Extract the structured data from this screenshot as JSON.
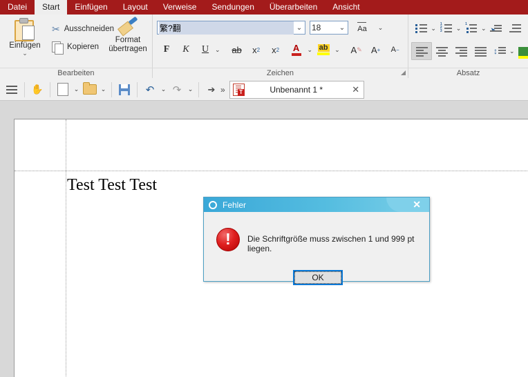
{
  "menubar": {
    "items": [
      {
        "label": "Datei",
        "active": false
      },
      {
        "label": "Start",
        "active": true
      },
      {
        "label": "Einfügen",
        "active": false
      },
      {
        "label": "Layout",
        "active": false
      },
      {
        "label": "Verweise",
        "active": false
      },
      {
        "label": "Sendungen",
        "active": false
      },
      {
        "label": "Überarbeiten",
        "active": false
      },
      {
        "label": "Ansicht",
        "active": false
      }
    ],
    "accent_color": "#a31b1b",
    "active_bg": "#eeeeee"
  },
  "ribbon": {
    "groups": [
      {
        "label": "Bearbeiten",
        "has_launcher": false
      },
      {
        "label": "Zeichen",
        "has_launcher": true
      },
      {
        "label": "Absatz",
        "has_launcher": false
      }
    ],
    "bearbeiten": {
      "paste_label": "Einfügen",
      "paste_chevron": "⌄",
      "cut_label": "Ausschneiden",
      "copy_label": "Kopieren",
      "format_painter_line1": "Format",
      "format_painter_line2": "übertragen"
    },
    "zeichen": {
      "font_name": "繁?翻",
      "font_size": "18",
      "combo_chevron": "⌄",
      "change_case_label": "Aa",
      "bold_label": "F",
      "italic_label": "K",
      "underline_label": "U",
      "strikethrough_label": "ab",
      "subscript_label": "x",
      "subscript_index": "2",
      "superscript_label": "x",
      "superscript_index": "2",
      "font_color_label": "A",
      "font_color_hex": "#c9211e",
      "highlight_label": "ab",
      "highlight_hex": "#ffff00",
      "clear_format_label": "A",
      "grow_font_label": "A",
      "grow_font_sign": "+",
      "shrink_font_label": "A",
      "shrink_font_sign": "−"
    },
    "absatz": {
      "bullet_list": "bullet-list",
      "numbered_list": "numbered-list",
      "outline_list": "outline-list",
      "increase_indent": "increase-indent",
      "decrease_indent": "decrease-indent",
      "align_left": "align-left",
      "align_center": "align-center",
      "align_right": "align-right",
      "align_justify": "align-justify",
      "line_spacing": "line-spacing",
      "shading": "shading",
      "numbers": [
        "1",
        "2",
        "3"
      ],
      "outline_number": "1"
    }
  },
  "toolbar2": {
    "menu_icon": "hamburger-icon",
    "hand_icon": "hand-icon",
    "new_icon": "new-document-icon",
    "open_icon": "open-folder-icon",
    "save_icon": "save-icon",
    "undo_icon": "undo-icon",
    "redo_icon": "redo-icon",
    "select_icon": "select-cursor-icon",
    "overflow_label": "»",
    "chevron": "⌄",
    "document_tab": {
      "title": "Unbenannt 1 *",
      "close_label": "✕",
      "badge": "T"
    }
  },
  "document": {
    "body_text": "Test Test Test",
    "page_background": "#ffffff",
    "canvas_background": "#d8d8d8"
  },
  "dialog": {
    "title": "Fehler",
    "title_icon": "error-ring-icon",
    "close_label": "✕",
    "message": "Die Schriftgröße muss zwischen 1 und 999 pt liegen.",
    "error_icon_glyph": "!",
    "ok_label": "OK",
    "title_gradient_from": "#3aa8d8",
    "title_gradient_to": "#7ccfe8",
    "focus_ring_color": "#0a78d6",
    "error_icon_color": "#e02020"
  }
}
